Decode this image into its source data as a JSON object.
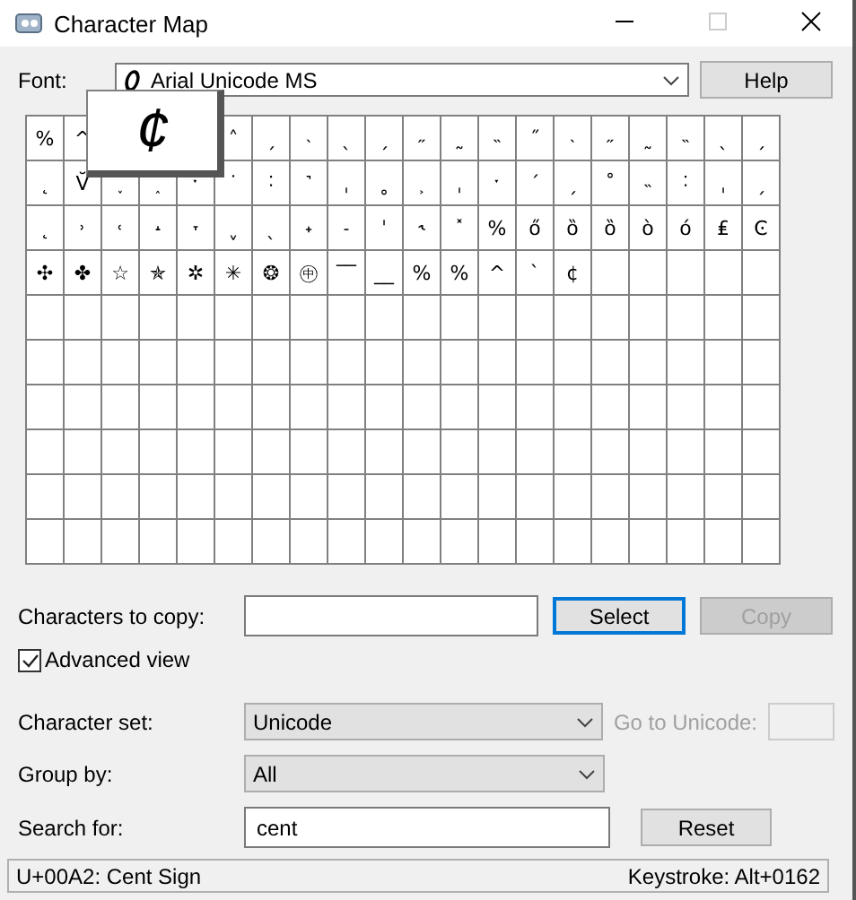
{
  "window": {
    "title": "Character Map"
  },
  "font": {
    "label": "Font:",
    "value": "Arial Unicode MS"
  },
  "help_button": "Help",
  "grid": {
    "cells": [
      [
        "%",
        "^",
        null,
        null,
        null,
        "˄",
        "ˏ",
        "˴",
        "ˎ",
        "ˏ",
        "˶",
        "˷",
        "˵",
        "˝",
        "˴",
        "˶",
        "˷",
        "˵",
        "ˎ",
        "ˏ"
      ],
      [
        "˛",
        "V̆",
        "˯",
        "˰",
        "ˑ",
        "˙",
        "˸",
        "˺",
        "ˌ",
        "˳",
        "˲",
        "ˌ",
        "ˑ",
        "ˊ",
        "ˏ",
        "˚",
        "˵",
        "˸",
        "ˌ",
        "ˏ"
      ],
      [
        "˛",
        "˒",
        "˓",
        "˔",
        "˕",
        "ˬ",
        "ˎ",
        "˖",
        "˗",
        "ˈ",
        "˞",
        "˟",
        "%",
        "ő",
        "ȍ",
        "ȍ",
        "ò",
        "ó",
        "₤",
        "Ͼ"
      ],
      [
        "✣",
        "✤",
        "☆",
        "✯",
        "✲",
        "✳",
        "❂",
        "㊥",
        "‾‾",
        "__",
        "%",
        "%",
        "^",
        "`",
        "¢"
      ]
    ]
  },
  "preview": {
    "char": "¢"
  },
  "copy_row": {
    "label": "Characters to copy:",
    "select": "Select",
    "copy": "Copy",
    "copy_disabled": true
  },
  "advanced_view": {
    "label": "Advanced view",
    "checked": true
  },
  "character_set": {
    "label": "Character set:",
    "value": "Unicode"
  },
  "goto_unicode": {
    "label": "Go to Unicode:",
    "disabled": true
  },
  "group_by": {
    "label": "Group by:",
    "value": "All"
  },
  "search": {
    "label": "Search for:",
    "value": "cent",
    "button": "Reset"
  },
  "status_bar": {
    "left": "U+00A2: Cent Sign",
    "right": "Keystroke: Alt+0162"
  }
}
